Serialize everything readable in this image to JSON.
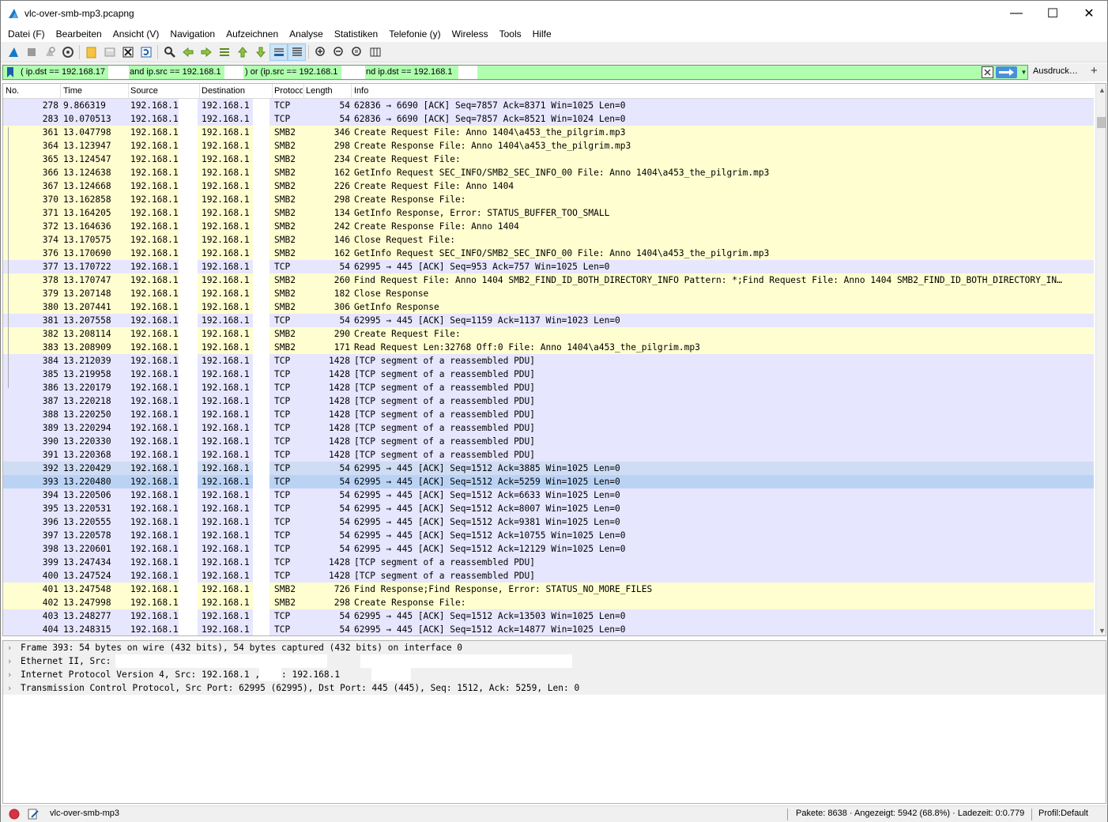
{
  "window": {
    "title": "vlc-over-smb-mp3.pcapng",
    "minimize": "—",
    "maximize": "☐",
    "close": "✕"
  },
  "menu": [
    "Datei (F)",
    "Bearbeiten",
    "Ansicht (V)",
    "Navigation",
    "Aufzeichnen",
    "Analyse",
    "Statistiken",
    "Telefonie (y)",
    "Wireless",
    "Tools",
    "Hilfe"
  ],
  "toolbar": {
    "icons": [
      "shark-start-icon",
      "stop-icon",
      "restart-icon",
      "options-icon",
      "open-file-icon",
      "save-icon",
      "close-file-icon",
      "reload-icon",
      "find-icon",
      "go-back-icon",
      "go-forward-icon",
      "go-to-packet-icon",
      "first-packet-icon",
      "last-packet-icon",
      "autoscroll-icon",
      "colorize-icon",
      "zoom-in-icon",
      "zoom-out-icon",
      "zoom-normal-icon",
      "resize-columns-icon"
    ]
  },
  "filter": {
    "segments": [
      "( ip.dst == 192.168.17",
      "and ip.src == 192.168.1",
      ") or (ip.src == 192.168.1",
      "nd ip.dst == 192.168.1"
    ],
    "expression_label": "Ausdruck…",
    "add_label": "+"
  },
  "packet_list": {
    "columns": [
      "No.",
      "Time",
      "Source",
      "Destination",
      "Protocol",
      "Length",
      "Info"
    ],
    "row_colors": {
      "tcp": "#e7e6ff",
      "smb2": "#fefed0",
      "selected_light": "#cfddf4",
      "selected": "#bad3f5"
    },
    "rows": [
      {
        "no": "278",
        "time": "9.866319",
        "src": "192.168.1",
        "dst": "192.168.1",
        "proto": "TCP",
        "len": "54",
        "info": "62836 → 6690 [ACK] Seq=7857 Ack=8371 Win=1025 Len=0",
        "style": "tcp"
      },
      {
        "no": "283",
        "time": "10.070513",
        "src": "192.168.1",
        "dst": "192.168.1",
        "proto": "TCP",
        "len": "54",
        "info": "62836 → 6690 [ACK] Seq=7857 Ack=8521 Win=1024 Len=0",
        "style": "tcp"
      },
      {
        "no": "361",
        "time": "13.047798",
        "src": "192.168.1",
        "dst": "192.168.1",
        "proto": "SMB2",
        "len": "346",
        "info": "Create Request File: Anno 1404\\a453_the_pilgrim.mp3",
        "style": "smb2"
      },
      {
        "no": "364",
        "time": "13.123947",
        "src": "192.168.1",
        "dst": "192.168.1",
        "proto": "SMB2",
        "len": "298",
        "info": "Create Response File: Anno 1404\\a453_the_pilgrim.mp3",
        "style": "smb2"
      },
      {
        "no": "365",
        "time": "13.124547",
        "src": "192.168.1",
        "dst": "192.168.1",
        "proto": "SMB2",
        "len": "234",
        "info": "Create Request File:",
        "style": "smb2"
      },
      {
        "no": "366",
        "time": "13.124638",
        "src": "192.168.1",
        "dst": "192.168.1",
        "proto": "SMB2",
        "len": "162",
        "info": "GetInfo Request SEC_INFO/SMB2_SEC_INFO_00 File: Anno 1404\\a453_the_pilgrim.mp3",
        "style": "smb2"
      },
      {
        "no": "367",
        "time": "13.124668",
        "src": "192.168.1",
        "dst": "192.168.1",
        "proto": "SMB2",
        "len": "226",
        "info": "Create Request File: Anno 1404",
        "style": "smb2"
      },
      {
        "no": "370",
        "time": "13.162858",
        "src": "192.168.1",
        "dst": "192.168.1",
        "proto": "SMB2",
        "len": "298",
        "info": "Create Response File:",
        "style": "smb2"
      },
      {
        "no": "371",
        "time": "13.164205",
        "src": "192.168.1",
        "dst": "192.168.1",
        "proto": "SMB2",
        "len": "134",
        "info": "GetInfo Response, Error: STATUS_BUFFER_TOO_SMALL",
        "style": "smb2"
      },
      {
        "no": "372",
        "time": "13.164636",
        "src": "192.168.1",
        "dst": "192.168.1",
        "proto": "SMB2",
        "len": "242",
        "info": "Create Response File: Anno 1404",
        "style": "smb2"
      },
      {
        "no": "374",
        "time": "13.170575",
        "src": "192.168.1",
        "dst": "192.168.1",
        "proto": "SMB2",
        "len": "146",
        "info": "Close Request File:",
        "style": "smb2"
      },
      {
        "no": "376",
        "time": "13.170690",
        "src": "192.168.1",
        "dst": "192.168.1",
        "proto": "SMB2",
        "len": "162",
        "info": "GetInfo Request SEC_INFO/SMB2_SEC_INFO_00 File: Anno 1404\\a453_the_pilgrim.mp3",
        "style": "smb2"
      },
      {
        "no": "377",
        "time": "13.170722",
        "src": "192.168.1",
        "dst": "192.168.1",
        "proto": "TCP",
        "len": "54",
        "info": "62995 → 445 [ACK] Seq=953 Ack=757 Win=1025 Len=0",
        "style": "tcp"
      },
      {
        "no": "378",
        "time": "13.170747",
        "src": "192.168.1",
        "dst": "192.168.1",
        "proto": "SMB2",
        "len": "260",
        "info": "Find Request File: Anno 1404 SMB2_FIND_ID_BOTH_DIRECTORY_INFO Pattern: *;Find Request File: Anno 1404 SMB2_FIND_ID_BOTH_DIRECTORY_IN…",
        "style": "smb2"
      },
      {
        "no": "379",
        "time": "13.207148",
        "src": "192.168.1",
        "dst": "192.168.1",
        "proto": "SMB2",
        "len": "182",
        "info": "Close Response",
        "style": "smb2"
      },
      {
        "no": "380",
        "time": "13.207441",
        "src": "192.168.1",
        "dst": "192.168.1",
        "proto": "SMB2",
        "len": "306",
        "info": "GetInfo Response",
        "style": "smb2"
      },
      {
        "no": "381",
        "time": "13.207558",
        "src": "192.168.1",
        "dst": "192.168.1",
        "proto": "TCP",
        "len": "54",
        "info": "62995 → 445 [ACK] Seq=1159 Ack=1137 Win=1023 Len=0",
        "style": "tcp"
      },
      {
        "no": "382",
        "time": "13.208114",
        "src": "192.168.1",
        "dst": "192.168.1",
        "proto": "SMB2",
        "len": "290",
        "info": "Create Request File:",
        "style": "smb2"
      },
      {
        "no": "383",
        "time": "13.208909",
        "src": "192.168.1",
        "dst": "192.168.1",
        "proto": "SMB2",
        "len": "171",
        "info": "Read Request Len:32768 Off:0 File: Anno 1404\\a453_the_pilgrim.mp3",
        "style": "smb2"
      },
      {
        "no": "384",
        "time": "13.212039",
        "src": "192.168.1",
        "dst": "192.168.1",
        "proto": "TCP",
        "len": "1428",
        "info": "[TCP segment of a reassembled PDU]",
        "style": "tcp"
      },
      {
        "no": "385",
        "time": "13.219958",
        "src": "192.168.1",
        "dst": "192.168.1",
        "proto": "TCP",
        "len": "1428",
        "info": "[TCP segment of a reassembled PDU]",
        "style": "tcp"
      },
      {
        "no": "386",
        "time": "13.220179",
        "src": "192.168.1",
        "dst": "192.168.1",
        "proto": "TCP",
        "len": "1428",
        "info": "[TCP segment of a reassembled PDU]",
        "style": "tcp"
      },
      {
        "no": "387",
        "time": "13.220218",
        "src": "192.168.1",
        "dst": "192.168.1",
        "proto": "TCP",
        "len": "1428",
        "info": "[TCP segment of a reassembled PDU]",
        "style": "tcp"
      },
      {
        "no": "388",
        "time": "13.220250",
        "src": "192.168.1",
        "dst": "192.168.1",
        "proto": "TCP",
        "len": "1428",
        "info": "[TCP segment of a reassembled PDU]",
        "style": "tcp"
      },
      {
        "no": "389",
        "time": "13.220294",
        "src": "192.168.1",
        "dst": "192.168.1",
        "proto": "TCP",
        "len": "1428",
        "info": "[TCP segment of a reassembled PDU]",
        "style": "tcp"
      },
      {
        "no": "390",
        "time": "13.220330",
        "src": "192.168.1",
        "dst": "192.168.1",
        "proto": "TCP",
        "len": "1428",
        "info": "[TCP segment of a reassembled PDU]",
        "style": "tcp"
      },
      {
        "no": "391",
        "time": "13.220368",
        "src": "192.168.1",
        "dst": "192.168.1",
        "proto": "TCP",
        "len": "1428",
        "info": "[TCP segment of a reassembled PDU]",
        "style": "tcp"
      },
      {
        "no": "392",
        "time": "13.220429",
        "src": "192.168.1",
        "dst": "192.168.1",
        "proto": "TCP",
        "len": "54",
        "info": "62995 → 445 [ACK] Seq=1512 Ack=3885 Win=1025 Len=0",
        "style": "selected_light"
      },
      {
        "no": "393",
        "time": "13.220480",
        "src": "192.168.1",
        "dst": "192.168.1",
        "proto": "TCP",
        "len": "54",
        "info": "62995 → 445 [ACK] Seq=1512 Ack=5259 Win=1025 Len=0",
        "style": "selected"
      },
      {
        "no": "394",
        "time": "13.220506",
        "src": "192.168.1",
        "dst": "192.168.1",
        "proto": "TCP",
        "len": "54",
        "info": "62995 → 445 [ACK] Seq=1512 Ack=6633 Win=1025 Len=0",
        "style": "tcp"
      },
      {
        "no": "395",
        "time": "13.220531",
        "src": "192.168.1",
        "dst": "192.168.1",
        "proto": "TCP",
        "len": "54",
        "info": "62995 → 445 [ACK] Seq=1512 Ack=8007 Win=1025 Len=0",
        "style": "tcp"
      },
      {
        "no": "396",
        "time": "13.220555",
        "src": "192.168.1",
        "dst": "192.168.1",
        "proto": "TCP",
        "len": "54",
        "info": "62995 → 445 [ACK] Seq=1512 Ack=9381 Win=1025 Len=0",
        "style": "tcp"
      },
      {
        "no": "397",
        "time": "13.220578",
        "src": "192.168.1",
        "dst": "192.168.1",
        "proto": "TCP",
        "len": "54",
        "info": "62995 → 445 [ACK] Seq=1512 Ack=10755 Win=1025 Len=0",
        "style": "tcp"
      },
      {
        "no": "398",
        "time": "13.220601",
        "src": "192.168.1",
        "dst": "192.168.1",
        "proto": "TCP",
        "len": "54",
        "info": "62995 → 445 [ACK] Seq=1512 Ack=12129 Win=1025 Len=0",
        "style": "tcp"
      },
      {
        "no": "399",
        "time": "13.247434",
        "src": "192.168.1",
        "dst": "192.168.1",
        "proto": "TCP",
        "len": "1428",
        "info": "[TCP segment of a reassembled PDU]",
        "style": "tcp"
      },
      {
        "no": "400",
        "time": "13.247524",
        "src": "192.168.1",
        "dst": "192.168.1",
        "proto": "TCP",
        "len": "1428",
        "info": "[TCP segment of a reassembled PDU]",
        "style": "tcp"
      },
      {
        "no": "401",
        "time": "13.247548",
        "src": "192.168.1",
        "dst": "192.168.1",
        "proto": "SMB2",
        "len": "726",
        "info": "Find Response;Find Response, Error: STATUS_NO_MORE_FILES",
        "style": "smb2"
      },
      {
        "no": "402",
        "time": "13.247998",
        "src": "192.168.1",
        "dst": "192.168.1",
        "proto": "SMB2",
        "len": "298",
        "info": "Create Response File:",
        "style": "smb2"
      },
      {
        "no": "403",
        "time": "13.248277",
        "src": "192.168.1",
        "dst": "192.168.1",
        "proto": "TCP",
        "len": "54",
        "info": "62995 → 445 [ACK] Seq=1512 Ack=13503 Win=1025 Len=0",
        "style": "tcp"
      },
      {
        "no": "404",
        "time": "13.248315",
        "src": "192.168.1",
        "dst": "192.168.1",
        "proto": "TCP",
        "len": "54",
        "info": "62995 → 445 [ACK] Seq=1512 Ack=14877 Win=1025 Len=0",
        "style": "tcp"
      }
    ]
  },
  "details": [
    "Frame 393: 54 bytes on wire (432 bits), 54 bytes captured (432 bits) on interface 0",
    "Ethernet II, Src:                                    , Dst:",
    "Internet Protocol Version 4, Src: 192.168.1     , Dst: 192.168.1",
    "Transmission Control Protocol, Src Port: 62995 (62995), Dst Port: 445 (445), Seq: 1512, Ack: 5259, Len: 0"
  ],
  "status": {
    "file": "vlc-over-smb-mp3",
    "stats": "Pakete: 8638 · Angezeigt: 5942 (68.8%) · Ladezeit: 0:0.779",
    "profile": "Profil:Default"
  }
}
